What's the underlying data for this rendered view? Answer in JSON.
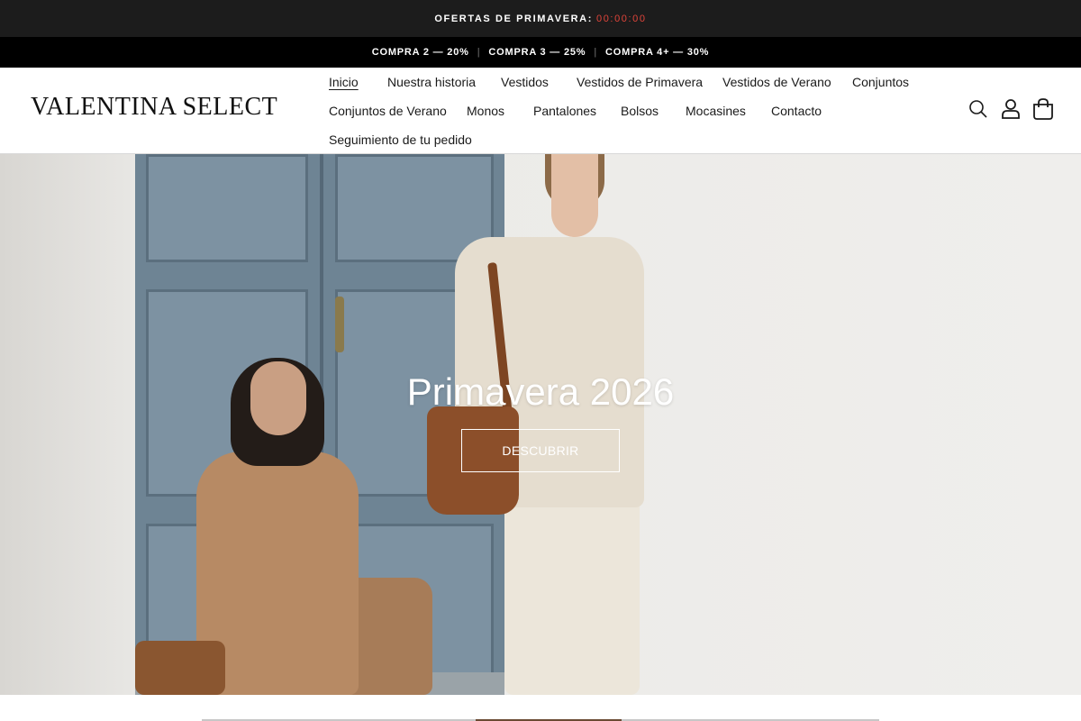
{
  "countdown": {
    "label": "OFERTAS DE PRIMAVERA:",
    "timer": "00:00:00",
    "timer_color": "#e0443a"
  },
  "promo": {
    "items": [
      "COMPRA 2 — 20%",
      "COMPRA 3 — 25%",
      "COMPRA 4+ — 30%"
    ],
    "separator": "|"
  },
  "header": {
    "logo": "VALENTINA SELECT",
    "nav": [
      {
        "label": "Inicio",
        "active": true
      },
      {
        "label": "Nuestra historia"
      },
      {
        "label": "Vestidos"
      },
      {
        "label": "Vestidos de Primavera"
      },
      {
        "label": "Vestidos de Verano"
      },
      {
        "label": "Conjuntos"
      },
      {
        "label": "Conjuntos de Verano"
      },
      {
        "label": "Monos"
      },
      {
        "label": "Pantalones"
      },
      {
        "label": "Bolsos"
      },
      {
        "label": "Mocasines"
      },
      {
        "label": "Contacto"
      },
      {
        "label": "Seguimiento de tu pedido"
      }
    ],
    "icons": [
      "search-icon",
      "account-icon",
      "cart-icon"
    ]
  },
  "hero": {
    "title": "Primavera 2026",
    "cta": "DESCUBRIR"
  }
}
